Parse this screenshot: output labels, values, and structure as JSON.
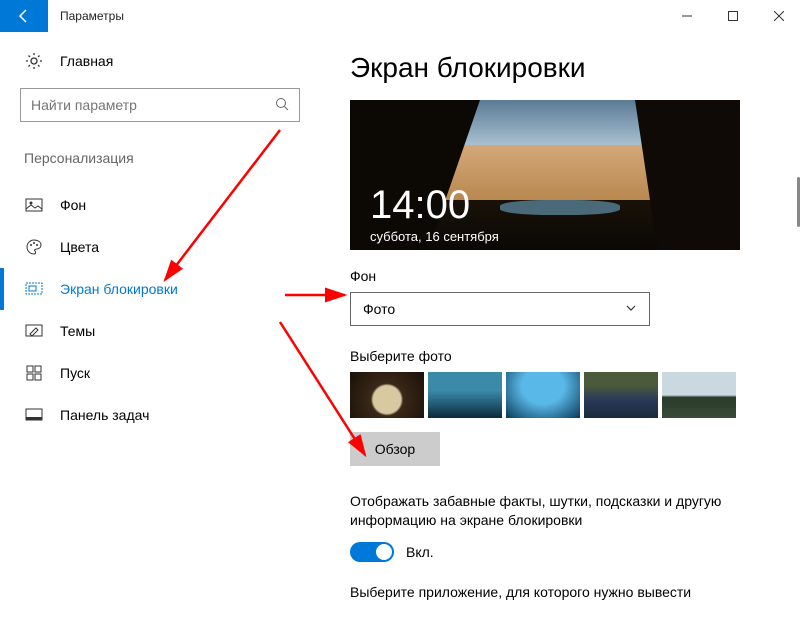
{
  "window": {
    "title": "Параметры"
  },
  "sidebar": {
    "home": "Главная",
    "search_placeholder": "Найти параметр",
    "section": "Персонализация",
    "items": [
      {
        "label": "Фон",
        "icon": "image-icon"
      },
      {
        "label": "Цвета",
        "icon": "palette-icon"
      },
      {
        "label": "Экран блокировки",
        "icon": "lock-screen-icon",
        "active": true
      },
      {
        "label": "Темы",
        "icon": "brush-icon"
      },
      {
        "label": "Пуск",
        "icon": "start-icon"
      },
      {
        "label": "Панель задач",
        "icon": "taskbar-icon"
      }
    ]
  },
  "main": {
    "title": "Экран блокировки",
    "preview": {
      "time": "14:00",
      "date": "суббота, 16 сентября"
    },
    "background_label": "Фон",
    "background_value": "Фото",
    "choose_label": "Выберите фото",
    "browse": "Обзор",
    "facts_text": "Отображать забавные факты, шутки, подсказки и другую информацию на экране блокировки",
    "toggle_label": "Вкл.",
    "app_text": "Выберите приложение, для которого нужно вывести"
  }
}
